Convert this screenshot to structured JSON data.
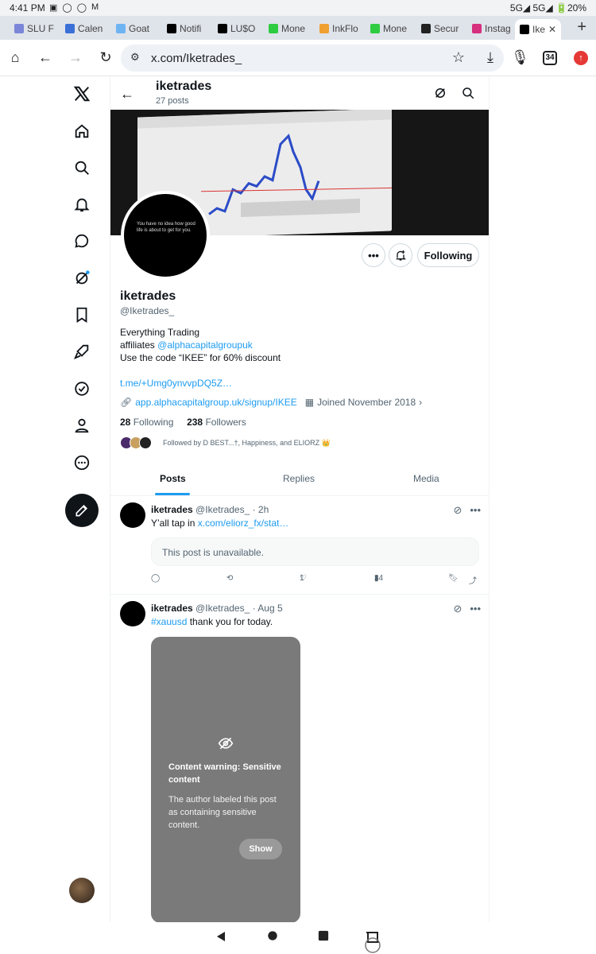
{
  "status": {
    "time": "4:41 PM",
    "right": "5G◢ 5G◢ 🔋20%",
    "icons": [
      "image-icon",
      "whatsapp-icon",
      "whatsapp-icon",
      "gmail-icon"
    ]
  },
  "tabs": [
    {
      "label": "SLU F",
      "color": "#7b86d8"
    },
    {
      "label": "Calen",
      "color": "#3b6fd8"
    },
    {
      "label": "Goat",
      "color": "#6fb4f2"
    },
    {
      "label": "Notifi",
      "color": "#000000"
    },
    {
      "label": "LU$O",
      "color": "#000000"
    },
    {
      "label": "Mone",
      "color": "#2ecc40"
    },
    {
      "label": "InkFlo",
      "color": "#f0a030"
    },
    {
      "label": "Mone",
      "color": "#2ecc40"
    },
    {
      "label": "Secur",
      "color": "#222222"
    },
    {
      "label": "Instag",
      "color": "#d6307f"
    },
    {
      "label": "Ike",
      "color": "#000000"
    }
  ],
  "browser": {
    "url": "x.com/Iketrades_",
    "tab_count": "34"
  },
  "header": {
    "name": "iketrades",
    "posts": "27 posts"
  },
  "profile": {
    "pfp_text": "You have no idea how good life is about to get for you.",
    "name": "iketrades",
    "handle": "@Iketrades_",
    "bio_line1": "Everything Trading",
    "bio_line2_prefix": "affiliates ",
    "bio_line2_link": "@alphacapitalgroupuk",
    "bio_line3": "Use the code “IKEE” for 60% discount",
    "bio_link": "t.me/+Umg0ynvvpDQ5Z…",
    "website": "app.alphacapitalgroup.uk/signup/IKEE",
    "joined": "Joined November 2018",
    "following_count": "28",
    "following_label": "Following",
    "followers_count": "238",
    "followers_label": "Followers",
    "followed_by": "Followed by D BEST...†, Happiness, and ELIORZ 👑",
    "follow_button": "Following",
    "more_button": "•••"
  },
  "profile_tabs": [
    "Posts",
    "Replies",
    "Media"
  ],
  "tweets": [
    {
      "name": "iketrades",
      "handle": "@Iketrades_ · 2h",
      "text_prefix": "Y’all tap in ",
      "text_link": "x.com/eliorz_fx/stat…",
      "unavailable": "This post is unavailable.",
      "likes": "1",
      "views": "34"
    },
    {
      "name": "iketrades",
      "handle": "@Iketrades_ · Aug 5",
      "hashtag": "#xauusd",
      "text": " thank you for today.",
      "warn_title": "Content warning: Sensitive content",
      "warn_desc": "The author labeled this post as containing sensitive content.",
      "show": "Show"
    }
  ],
  "colors": {
    "accent": "#1d9bf0",
    "text": "#0f1419",
    "muted": "#536471"
  }
}
